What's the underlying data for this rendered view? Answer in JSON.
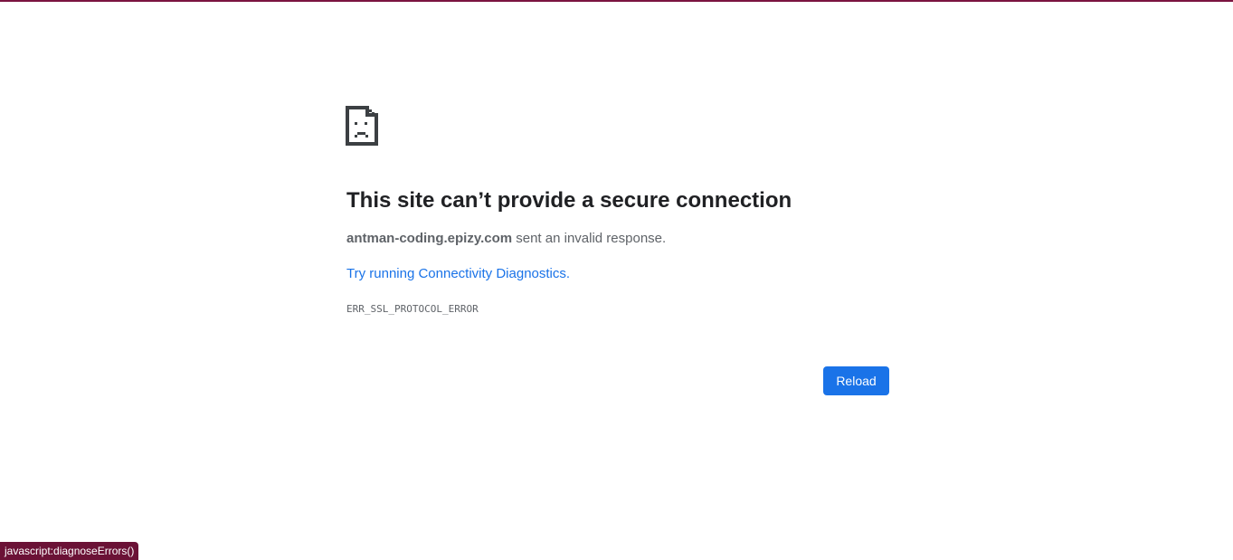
{
  "error_page": {
    "icon": "sad-document-icon",
    "title": "This site can’t provide a secure connection",
    "host": "antman-coding.epizy.com",
    "message_suffix": " sent an invalid response.",
    "diagnostics_link": "Try running Connectivity Diagnostics",
    "diagnostics_period": ".",
    "error_code": "ERR_SSL_PROTOCOL_ERROR",
    "reload_label": "Reload"
  },
  "status_bar": {
    "url": "javascript:diagnoseErrors()"
  },
  "colors": {
    "accent": "#1a73e8",
    "text_primary": "#202124",
    "text_secondary": "#5f6368",
    "theme": "#7b1440"
  }
}
